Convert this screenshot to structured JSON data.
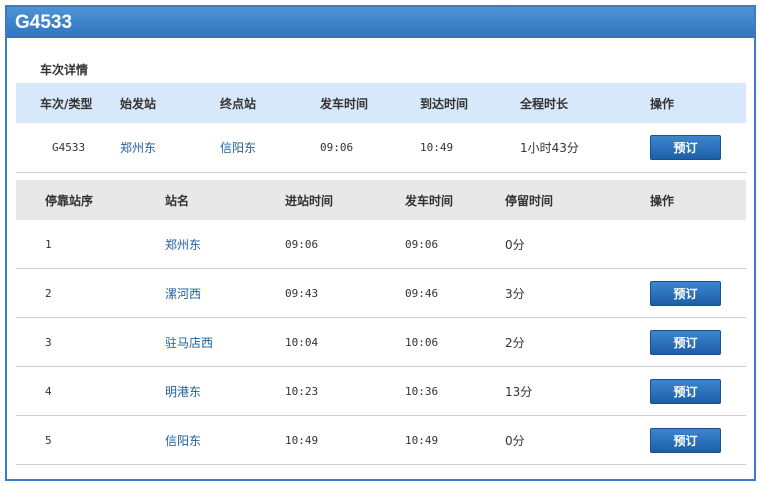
{
  "title": "G4533",
  "section_label": "车次详情",
  "train_table": {
    "headers": [
      "车次/类型",
      "始发站",
      "终点站",
      "发车时间",
      "到达时间",
      "全程时长",
      "操作"
    ],
    "row": {
      "train": "G4533",
      "origin": "郑州东",
      "destination": "信阳东",
      "depart": "09:06",
      "arrive": "10:49",
      "duration": "1小时43分",
      "action": "预订"
    }
  },
  "stops_table": {
    "headers": [
      "停靠站序",
      "站名",
      "进站时间",
      "发车时间",
      "停留时间",
      "操作"
    ],
    "rows": [
      {
        "seq": "1",
        "station": "郑州东",
        "arrive": "09:06",
        "depart": "09:06",
        "stay": "0分",
        "action": ""
      },
      {
        "seq": "2",
        "station": "漯河西",
        "arrive": "09:43",
        "depart": "09:46",
        "stay": "3分",
        "action": "预订"
      },
      {
        "seq": "3",
        "station": "驻马店西",
        "arrive": "10:04",
        "depart": "10:06",
        "stay": "2分",
        "action": "预订"
      },
      {
        "seq": "4",
        "station": "明港东",
        "arrive": "10:23",
        "depart": "10:36",
        "stay": "13分",
        "action": "预订"
      },
      {
        "seq": "5",
        "station": "信阳东",
        "arrive": "10:49",
        "depart": "10:49",
        "stay": "0分",
        "action": "预订"
      }
    ]
  }
}
